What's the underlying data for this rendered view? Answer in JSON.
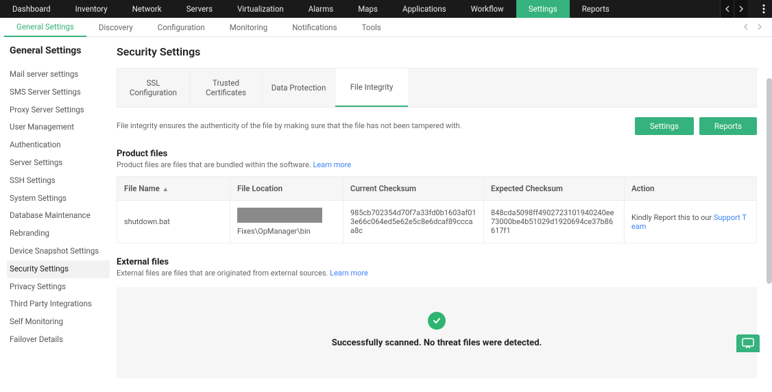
{
  "topnav": {
    "items": [
      "Dashboard",
      "Inventory",
      "Network",
      "Servers",
      "Virtualization",
      "Alarms",
      "Maps",
      "Applications",
      "Workflow",
      "Settings",
      "Reports"
    ],
    "active": "Settings"
  },
  "subnav": {
    "items": [
      "General Settings",
      "Discovery",
      "Configuration",
      "Monitoring",
      "Notifications",
      "Tools"
    ],
    "active": "General Settings"
  },
  "sidebar": {
    "title": "General Settings",
    "items": [
      "Mail server settings",
      "SMS Server Settings",
      "Proxy Server Settings",
      "User Management",
      "Authentication",
      "Server Settings",
      "SSH Settings",
      "System Settings",
      "Database Maintenance",
      "Rebranding",
      "Device Snapshot Settings",
      "Security Settings",
      "Privacy Settings",
      "Third Party Integrations",
      "Self Monitoring",
      "Failover Details"
    ],
    "active": "Security Settings"
  },
  "page": {
    "title": "Security Settings",
    "tabs": [
      {
        "line1": "SSL",
        "line2": "Configuration"
      },
      {
        "line1": "Trusted",
        "line2": "Certificates"
      },
      {
        "line1": "Data Protection",
        "line2": ""
      },
      {
        "line1": "File Integrity",
        "line2": ""
      }
    ],
    "active_tab": "File Integrity",
    "integrity_desc": "File integrity ensures the authenticity of the file by making sure that the file has not been tampered with.",
    "btn_settings": "Settings",
    "btn_reports": "Reports"
  },
  "product": {
    "heading": "Product files",
    "desc_prefix": "Product files are files that are bundled within the software. ",
    "learn_more": "Learn more",
    "columns": {
      "file_name": "File Name",
      "file_location": "File Location",
      "current_checksum": "Current Checksum",
      "expected_checksum": "Expected Checksum",
      "action": "Action"
    },
    "row": {
      "file_name": "shutdown.bat",
      "file_location": "Fixes\\OpManager\\bin",
      "current_checksum": "985cb702354d70f7a33fd0b1603af013e66c064ed5e62e5c8e6dcaf89cccaa8c",
      "expected_checksum": "848cda5098ff4902723101940240ee73000be4b51029d1920694ce37b86617f1",
      "action_prefix": "Kindly Report this to our ",
      "action_link": "Support Team"
    }
  },
  "external": {
    "heading": "External files",
    "desc_prefix": "External files are files that are originated from external sources. ",
    "learn_more": "Learn more",
    "success_msg": "Successfully scanned. No threat files were detected."
  }
}
